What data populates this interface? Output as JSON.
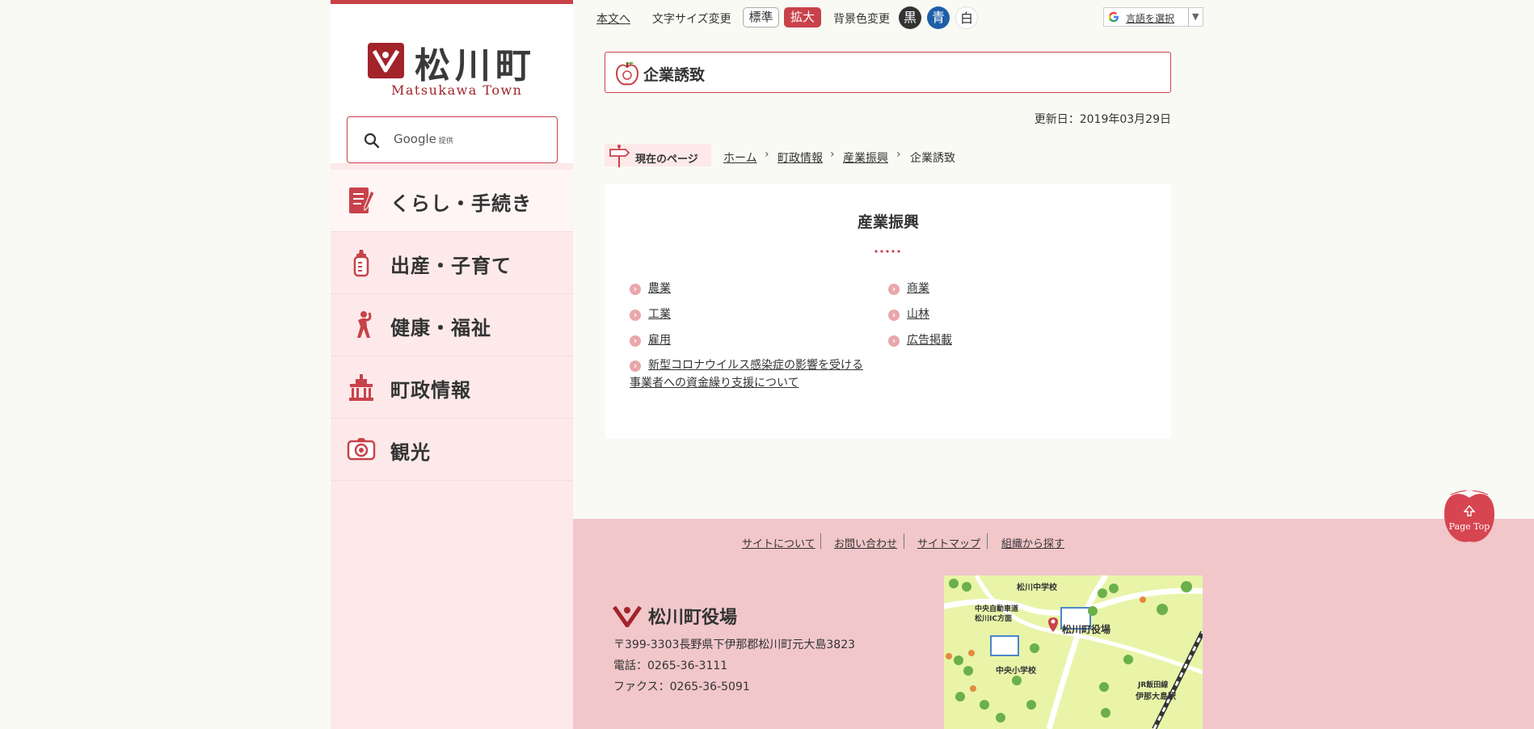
{
  "sidebar": {
    "logo_name": "松川町",
    "logo_en": "Matsukawa Town",
    "search": {
      "placeholder": "Google",
      "provider": "提供"
    },
    "nav": [
      {
        "label": "くらし・手続き",
        "icon": "document-pen-icon"
      },
      {
        "label": "出産・子育て",
        "icon": "baby-bottle-icon"
      },
      {
        "label": "健康・福祉",
        "icon": "stretching-person-icon"
      },
      {
        "label": "町政情報",
        "icon": "town-hall-icon"
      },
      {
        "label": "観光",
        "icon": "camera-icon"
      }
    ]
  },
  "utility": {
    "skip_link": "本文へ",
    "font_size_label": "文字サイズ変更",
    "font_normal": "標準",
    "font_large": "拡大",
    "bg_label": "背景色変更",
    "bg_black": "黒",
    "bg_blue": "青",
    "bg_white": "白",
    "translate": "言語を選択",
    "translate_arrow": "▼"
  },
  "page": {
    "title": "企業誘致",
    "updated": "更新日：2019年03月29日"
  },
  "breadcrumb": {
    "label": "現在のページ",
    "items": [
      "ホーム",
      "町政情報",
      "産業振興"
    ],
    "current": "企業誘致",
    "separator": "›"
  },
  "panel": {
    "heading": "産業振興",
    "links_left": [
      "農業",
      "工業",
      "雇用"
    ],
    "links_right": [
      "商業",
      "山林",
      "広告掲載"
    ],
    "long_link_line1": "新型コロナウイルス感染症の影響を受ける",
    "long_link_line2": "事業者への資金繰り支援について"
  },
  "footer": {
    "links": [
      "サイトについて",
      "お問い合わせ",
      "サイトマップ",
      "組織から探す"
    ],
    "org_name": "松川町役場",
    "address": "〒399-3303長野県下伊那郡松川町元大島3823",
    "phone": "電話：0265-36-3111",
    "fax": "ファクス：0265-36-5091",
    "map_labels": {
      "school1": "松川中学校",
      "ic": "中央自動車道",
      "ic2": "松川IC方面",
      "office": "松川町役場",
      "school2": "中央小学校",
      "line": "JR飯田線",
      "station": "伊那大島駅"
    }
  },
  "page_top": "Page Top",
  "colors": {
    "brand": "#c8424a",
    "sidebar_bg": "#fde9e9",
    "footer_bg": "#f1c7ca",
    "blue": "#1e5ea8"
  }
}
